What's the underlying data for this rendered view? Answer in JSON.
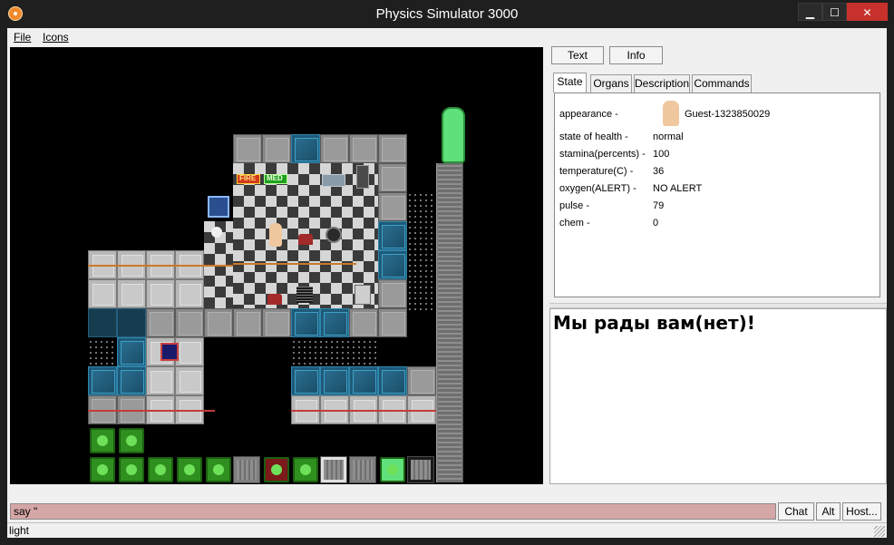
{
  "window": {
    "title": "Physics Simulator 3000"
  },
  "menu": {
    "file": "File",
    "icons": "Icons"
  },
  "side": {
    "buttons": {
      "text": "Text",
      "info": "Info"
    },
    "tabs": [
      "State",
      "Organs",
      "Description",
      "Commands"
    ],
    "active_tab": "State",
    "stats": {
      "appearance_label": "appearance -",
      "appearance_value": "Guest-1323850029",
      "rows": [
        {
          "label": "state of health -",
          "value": "normal"
        },
        {
          "label": "stamina(percents) -",
          "value": "100"
        },
        {
          "label": "temperature(C) -",
          "value": "36"
        },
        {
          "label": "oxygen(ALERT) -",
          "value": "NO ALERT"
        },
        {
          "label": "pulse -",
          "value": "79"
        },
        {
          "label": "chem -",
          "value": "0"
        }
      ]
    },
    "output": {
      "welcome": "Мы рады вам(нет)!"
    }
  },
  "map": {
    "signs": {
      "fire": "FIRE",
      "med": "MED"
    }
  },
  "input": {
    "value": "say \""
  },
  "buttons": {
    "chat": "Chat",
    "alt": "Alt",
    "host": "Host..."
  },
  "status": {
    "text": "light"
  },
  "colors": {
    "hud_green": "#2f8f1f",
    "input_bg": "#d5a6a6",
    "close": "#c7312b"
  }
}
